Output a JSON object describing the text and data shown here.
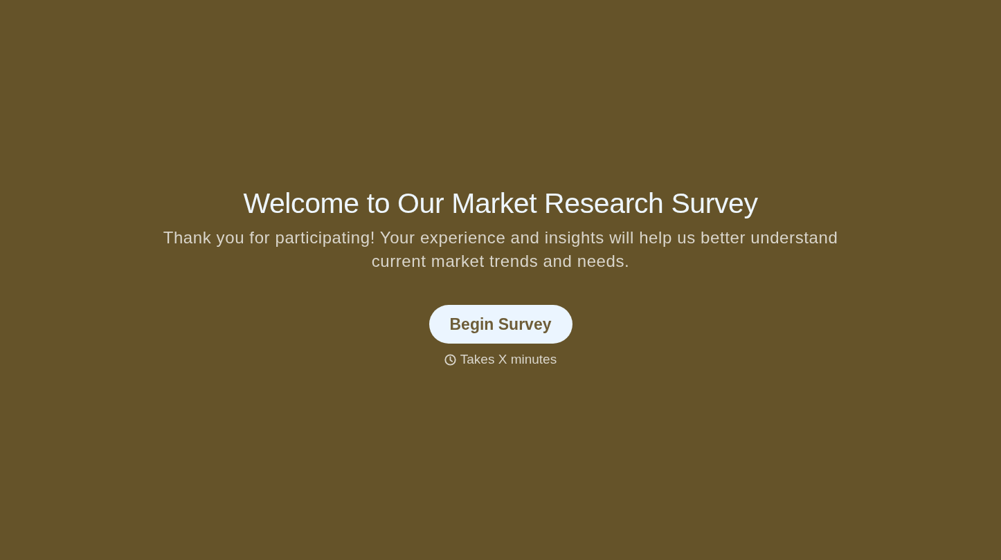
{
  "title": "Welcome to Our Market Research Survey",
  "intro": "Thank you for participating! Your experience and insights will help us better understand current market trends and needs.",
  "button": {
    "label": "Begin Survey"
  },
  "duration": "Takes X minutes"
}
